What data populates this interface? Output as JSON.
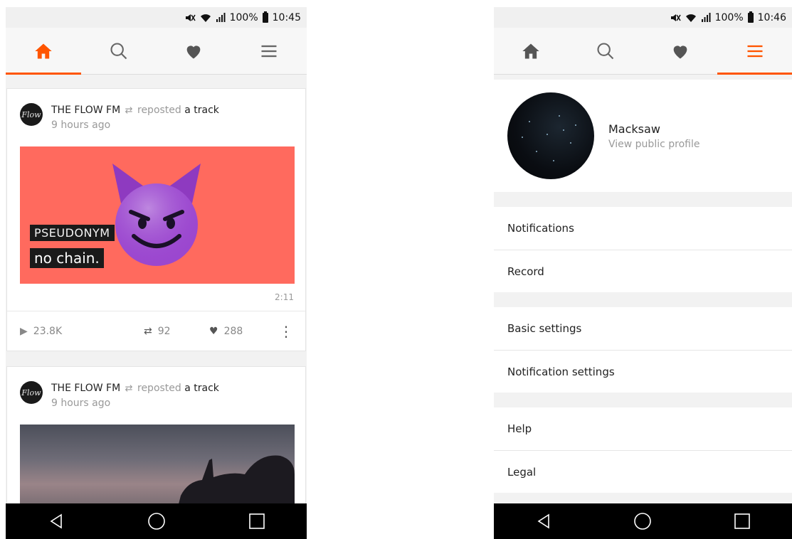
{
  "left": {
    "status": {
      "signal": "100%",
      "time": "10:45"
    },
    "tabs": [
      "home",
      "search",
      "likes",
      "more"
    ],
    "posts": [
      {
        "user": "THE FLOW FM",
        "action": "reposted",
        "object": "a track",
        "time": "9 hours ago",
        "avatar_text": "Flow",
        "art_lines": [
          "PSEUDONYM",
          "no chain."
        ],
        "duration": "2:11",
        "plays": "23.8K",
        "reposts": "92",
        "likes": "288"
      },
      {
        "user": "THE FLOW FM",
        "action": "reposted",
        "object": "a track",
        "time": "9 hours ago",
        "avatar_text": "Flow"
      }
    ]
  },
  "right": {
    "status": {
      "signal": "100%",
      "time": "10:46"
    },
    "profile": {
      "name": "Macksaw",
      "link": "View public profile"
    },
    "menu": {
      "notifications": "Notifications",
      "record": "Record",
      "basic_settings": "Basic settings",
      "notification_settings": "Notification settings",
      "help": "Help",
      "legal": "Legal"
    }
  },
  "colors": {
    "accent": "#ff5500",
    "artwork": "#ff6a5e",
    "navbar": "#000000"
  },
  "icons": [
    "home-icon",
    "search-icon",
    "heart-icon",
    "menu-icon",
    "repost-icon",
    "play-icon",
    "more-icon",
    "back-icon",
    "home-circle-icon",
    "recents-icon",
    "mute-icon",
    "wifi-icon",
    "signal-icon",
    "battery-icon"
  ]
}
